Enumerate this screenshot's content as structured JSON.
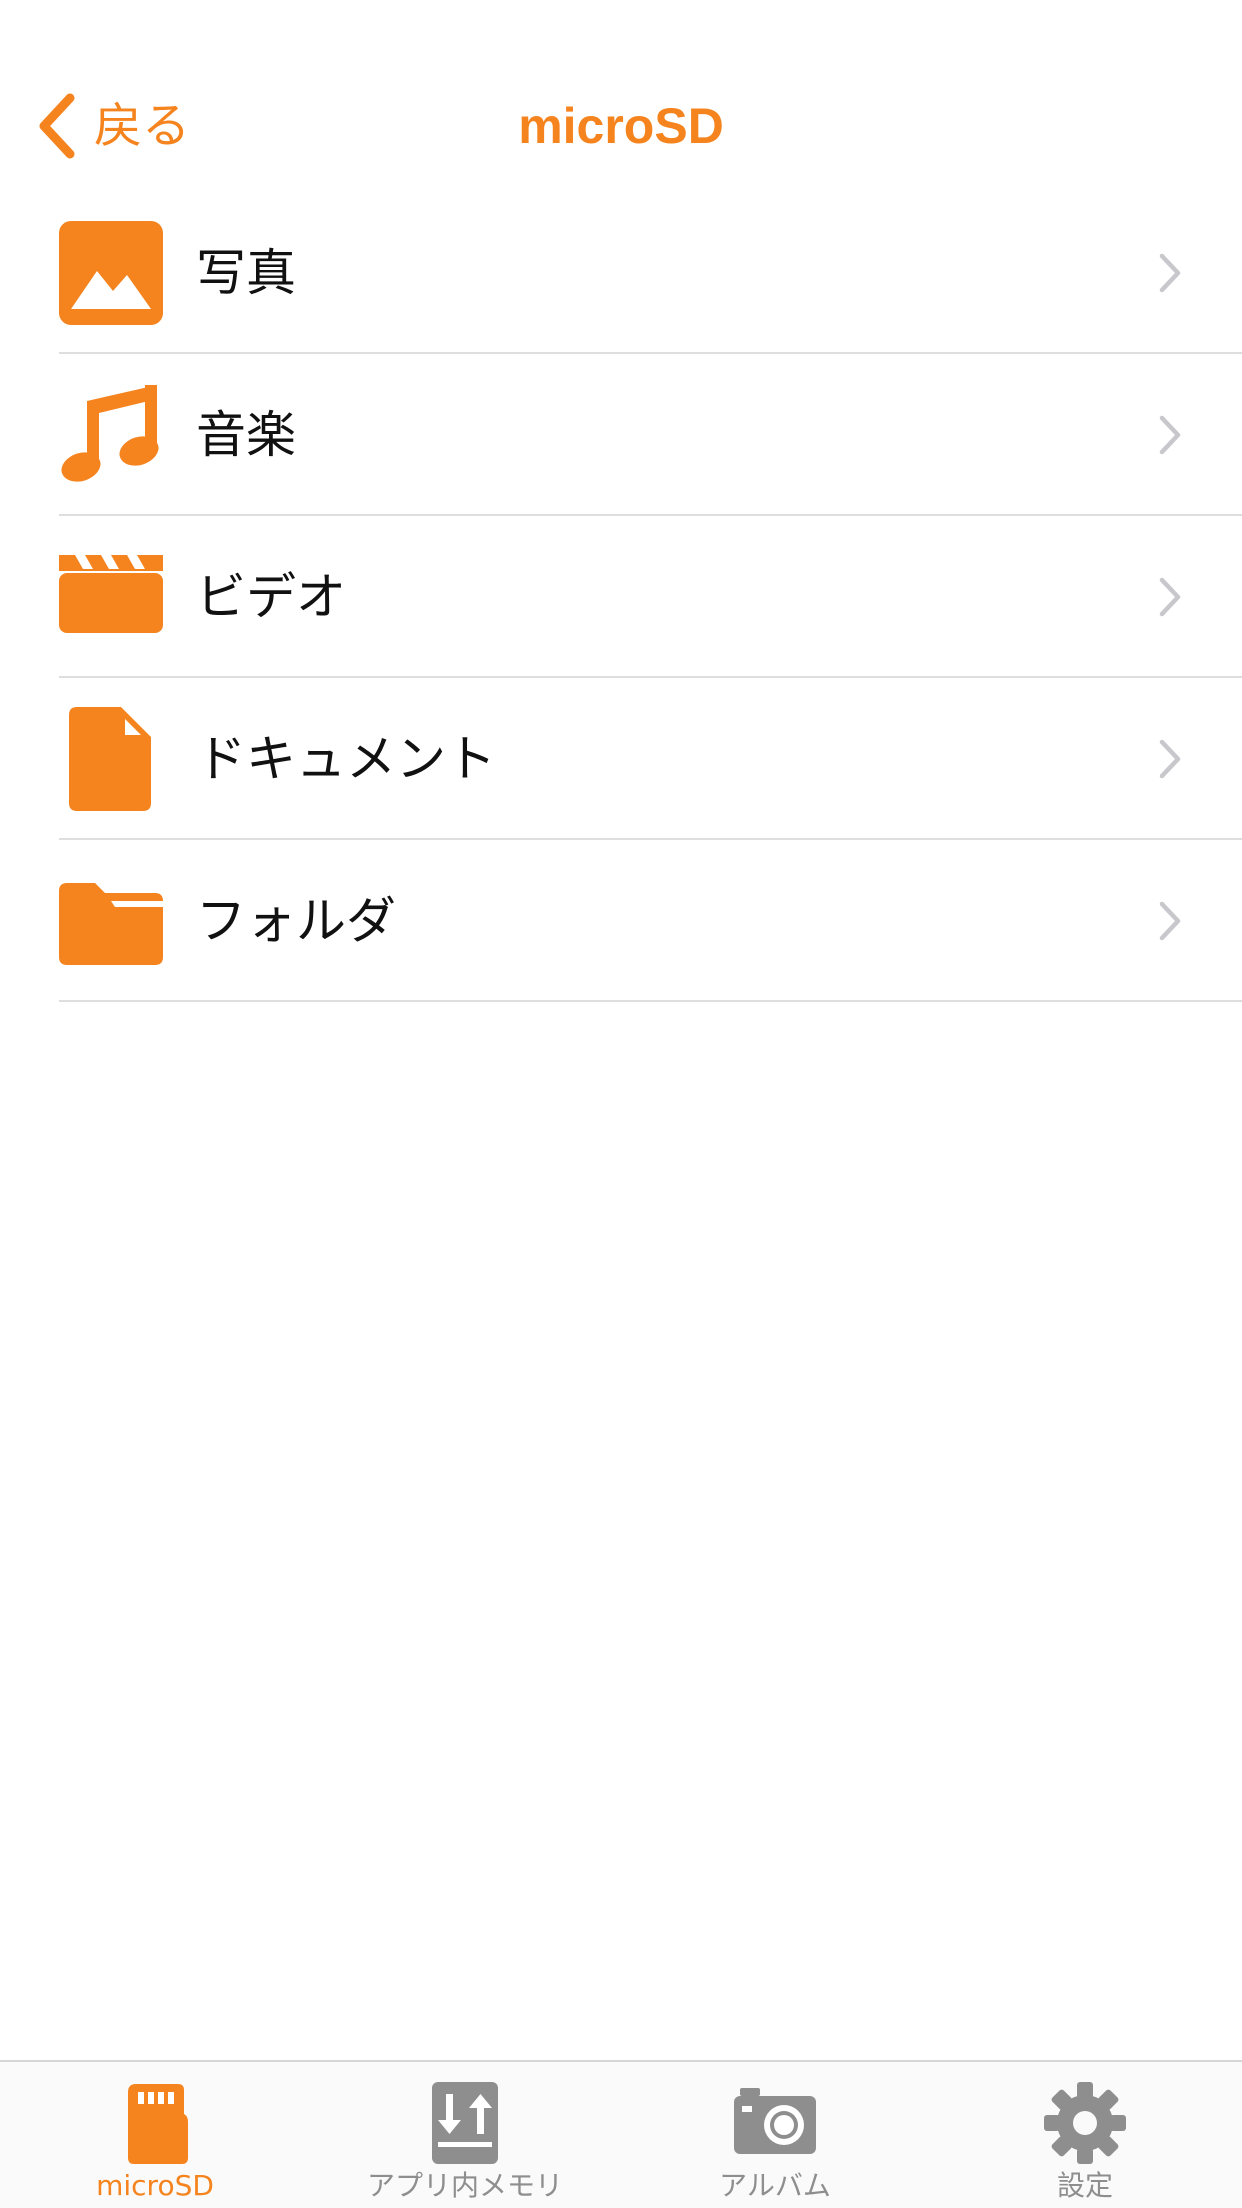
{
  "colors": {
    "accent": "#f5841f",
    "inactive": "#8e8e8e",
    "separator": "#dedede",
    "chevron": "#c7c7cc"
  },
  "navbar": {
    "back_label": "戻る",
    "back_icon": "chevron-left-icon",
    "title": "microSD"
  },
  "list": {
    "items": [
      {
        "label": "写真",
        "icon": "photo-icon"
      },
      {
        "label": "音楽",
        "icon": "music-note-icon"
      },
      {
        "label": "ビデオ",
        "icon": "clapperboard-icon"
      },
      {
        "label": "ドキュメント",
        "icon": "document-icon"
      },
      {
        "label": "フォルダ",
        "icon": "folder-icon"
      }
    ]
  },
  "tabbar": {
    "tabs": [
      {
        "label": "microSD",
        "icon": "sd-card-icon",
        "active": true
      },
      {
        "label": "アプリ内メモリ",
        "icon": "transfer-icon",
        "active": false
      },
      {
        "label": "アルバム",
        "icon": "camera-icon",
        "active": false
      },
      {
        "label": "設定",
        "icon": "gear-icon",
        "active": false
      }
    ]
  }
}
